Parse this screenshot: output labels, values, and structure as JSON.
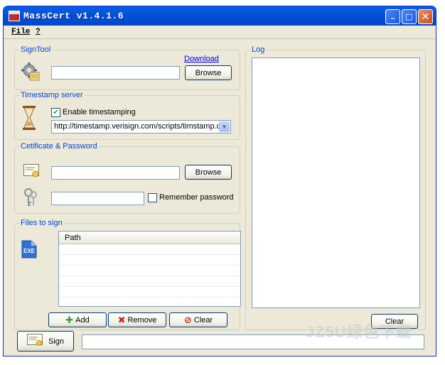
{
  "window": {
    "title": "MassCert v1.4.1.6",
    "minimize_label": "_",
    "maximize_label": "□",
    "close_label": "✕"
  },
  "menu": {
    "file": "File",
    "help": "?"
  },
  "signtool": {
    "legend": "SignTool",
    "download_link": "Download",
    "path_value": "",
    "browse_label": "Browse"
  },
  "timestamp": {
    "legend": "Timestamp server",
    "enable_label": "Enable timestamping",
    "enabled": true,
    "check_mark": "✔",
    "url": "http://timestamp.verisign.com/scripts/timstamp.dll"
  },
  "certificate": {
    "legend": "Cetificate & Password",
    "cert_value": "",
    "browse_label": "Browse",
    "password_value": "",
    "remember_label": "Remember password",
    "remember_checked": false
  },
  "files": {
    "legend": "Files to sign",
    "column_path": "Path",
    "add_label": "Add",
    "remove_label": "Remove",
    "clear_label": "Clear",
    "add_glyph": "✚",
    "remove_glyph": "✖",
    "clear_glyph": "⊘",
    "file_icon_text": "EXE"
  },
  "log": {
    "legend": "Log",
    "clear_label": "Clear"
  },
  "footer": {
    "sign_label": "Sign",
    "status_value": ""
  },
  "watermark": {
    "text": "JZ5U绿色下载"
  },
  "colors": {
    "title_blue": "#0250d4",
    "legend_blue": "#0046d5",
    "face": "#ece9d8"
  }
}
